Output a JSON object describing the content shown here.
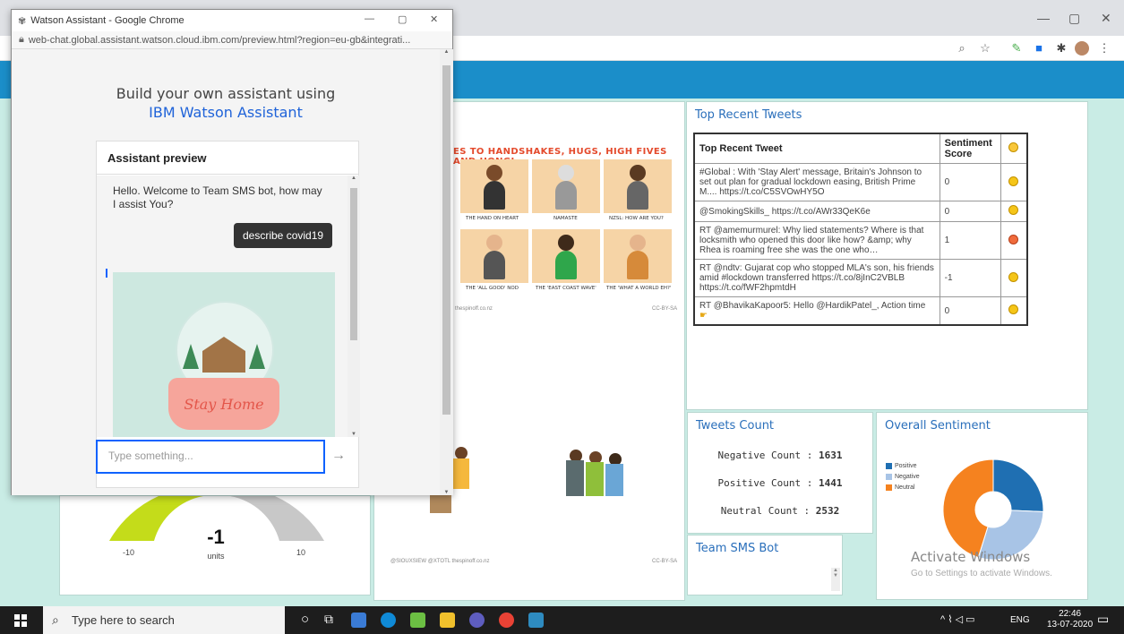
{
  "chat_window": {
    "title": "Watson Assistant - Google Chrome",
    "url": "web-chat.global.assistant.watson.cloud.ibm.com/preview.html?region=eu-gb&integrati...",
    "build_line1": "Build your own assistant using",
    "build_line2": "IBM Watson Assistant",
    "preview_title": "Assistant preview",
    "bot_message": "Hello. Welcome to Team SMS bot, how may I assist You?",
    "user_message": "describe covid19",
    "image_caption": "Stay Home",
    "input_placeholder": "Type something...",
    "send_icon": "arrow-right-icon"
  },
  "tweets": {
    "panel_title": "Top Recent Tweets",
    "headers": [
      "Top Recent Tweet",
      "Sentiment Score",
      ""
    ],
    "rows": [
      {
        "text": "#Global : With 'Stay Alert' message, Britain's Johnson to set out plan for gradual lockdown easing, British Prime M.... https://t.co/C5SVOwHY5O",
        "score": "0",
        "emoji": "neutral-face-icon"
      },
      {
        "text": "@SmokingSkills_ https://t.co/AWr33QeK6e",
        "score": "0",
        "emoji": "neutral-face-icon"
      },
      {
        "text": "RT @amemurmurel: Why lied statements? Where is that locksmith who opened this door like how? &amp; why Rhea is roaming free she was the one who…",
        "score": "1",
        "emoji": "angry-face-icon"
      },
      {
        "text": "RT @ndtv: Gujarat cop who stopped MLA's son, his friends amid #lockdown transferred https://t.co/8jInC2VBLB https://t.co/fWF2hpmtdH",
        "score": "-1",
        "emoji": "sad-face-icon"
      },
      {
        "text": "RT @BhavikaKapoor5: Hello @HardikPatel_, Action time",
        "score": "0",
        "emoji": "neutral-face-icon"
      }
    ]
  },
  "counts": {
    "panel_title": "Tweets Count",
    "negative_label": "Negative Count :",
    "negative": "1631",
    "positive_label": "Positive Count :",
    "positive": "1441",
    "neutral_label": "Neutral Count :",
    "neutral": "2532"
  },
  "sentiment": {
    "panel_title": "Overall Sentiment",
    "legend": [
      "Positive",
      "Negative",
      "Neutral"
    ],
    "colors": [
      "#1f6fb2",
      "#a8c4e6",
      "#f5821f"
    ],
    "values": [
      1441,
      1631,
      2532
    ]
  },
  "bot_panel": {
    "title": "Team SMS Bot"
  },
  "gauge": {
    "value": "-1",
    "unit": "units",
    "min": "-10",
    "max": "10"
  },
  "cartoon": {
    "header": "ES TO HANDSHAKES, HUGS, HIGH FIVES AND HONGI",
    "captions": [
      "THE HAND ON HEART",
      "NAMASTE",
      "NZSL: HOW ARE YOU?",
      "THE 'ALL GOOD' NOD",
      "THE 'EAST COAST WAVE'",
      "THE 'WHAT A WORLD EH?'"
    ],
    "credit1": "thespinoff.co.nz",
    "license": "CC-BY-SA",
    "credit2": "@SIOUXSIEW @XTOTL thespinoff.co.nz"
  },
  "watermark": {
    "line1": "Activate Windows",
    "line2": "Go to Settings to activate Windows."
  },
  "taskbar": {
    "search_placeholder": "Type here to search",
    "language": "ENG",
    "time": "22:46",
    "date": "13-07-2020"
  }
}
